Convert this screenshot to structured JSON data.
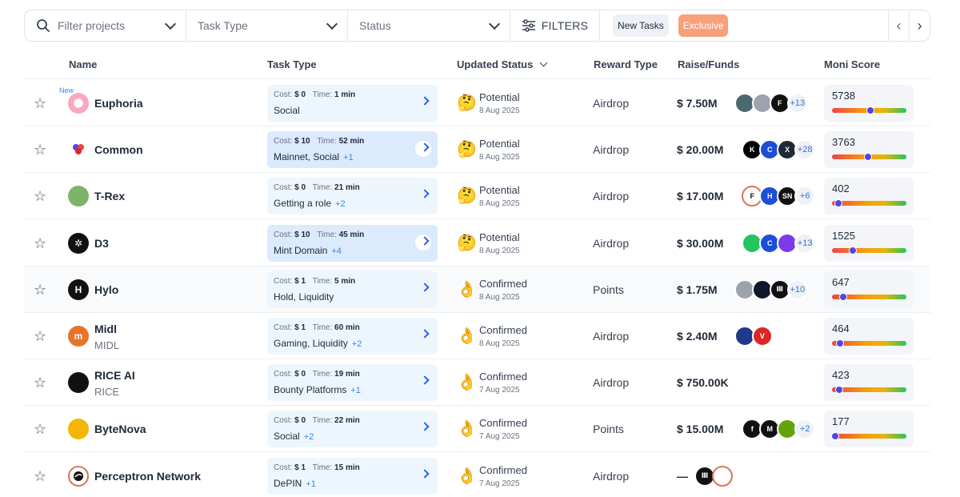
{
  "filters": {
    "search_placeholder": "Filter projects",
    "task_type": "Task Type",
    "status": "Status",
    "filters_label": "FILTERS",
    "chips": [
      "New Tasks",
      "Exclusive"
    ]
  },
  "columns": {
    "name": "Name",
    "task_type": "Task Type",
    "updated_status": "Updated Status",
    "reward_type": "Reward Type",
    "raise": "Raise/Funds",
    "moni": "Moni Score"
  },
  "labels": {
    "cost": "Cost:",
    "time": "Time:",
    "new": "New"
  },
  "rows": [
    {
      "name": "Euphoria",
      "sub": "",
      "is_new": true,
      "logo_color": "#f9a8c0",
      "logo_text": "",
      "cost": "$ 0",
      "time": "1 min",
      "task": "Social",
      "task_more": "",
      "status_emoji": "🤔",
      "status": "Potential",
      "date": "8 Aug 2025",
      "reward": "Airdrop",
      "raise": "$ 7.50M",
      "investors": [
        {
          "c": "#4b6a70",
          "t": ""
        },
        {
          "c": "#9ca3af",
          "t": ""
        },
        {
          "c": "#111111",
          "t": "F"
        }
      ],
      "investors_more": "+13",
      "moni": "5738",
      "moni_level": 0.52
    },
    {
      "name": "Common",
      "sub": "",
      "is_new": false,
      "logo_color": "#ffffff",
      "logo_text": "",
      "cost": "$ 10",
      "time": "52 min",
      "task": "Mainnet, Social",
      "task_more": "+1",
      "status_emoji": "🤔",
      "status": "Potential",
      "date": "8 Aug 2025",
      "reward": "Airdrop",
      "raise": "$ 20.00M",
      "investors": [
        {
          "c": "#000000",
          "t": "K"
        },
        {
          "c": "#1d4ed8",
          "t": "C"
        },
        {
          "c": "#1f2937",
          "t": "X"
        }
      ],
      "investors_more": "+28",
      "moni": "3763",
      "moni_level": 0.48
    },
    {
      "name": "T-Rex",
      "sub": "",
      "is_new": false,
      "logo_color": "#7fb36a",
      "logo_text": "",
      "cost": "$ 0",
      "time": "21 min",
      "task": "Getting a role",
      "task_more": "+2",
      "status_emoji": "🤔",
      "status": "Potential",
      "date": "8 Aug 2025",
      "reward": "Airdrop",
      "raise": "$ 17.00M",
      "investors": [
        {
          "c": "#ffffff",
          "t": "F"
        },
        {
          "c": "#1d4ed8",
          "t": "H"
        },
        {
          "c": "#111111",
          "t": "SN"
        }
      ],
      "investors_more": "+6",
      "moni": "402",
      "moni_level": 0.09
    },
    {
      "name": "D3",
      "sub": "",
      "is_new": false,
      "logo_color": "#111111",
      "logo_text": "✲",
      "cost": "$ 10",
      "time": "45 min",
      "task": "Mint Domain",
      "task_more": "+4",
      "status_emoji": "🤔",
      "status": "Potential",
      "date": "8 Aug 2025",
      "reward": "Airdrop",
      "raise": "$ 30.00M",
      "investors": [
        {
          "c": "#22c55e",
          "t": ""
        },
        {
          "c": "#1d4ed8",
          "t": "C"
        },
        {
          "c": "#7c3aed",
          "t": ""
        }
      ],
      "investors_more": "+13",
      "moni": "1525",
      "moni_level": 0.28
    },
    {
      "name": "Hylo",
      "sub": "",
      "is_new": false,
      "logo_color": "#111111",
      "logo_text": "H",
      "cost": "$ 1",
      "time": "5 min",
      "task": "Hold, Liquidity",
      "task_more": "",
      "status_emoji": "👌",
      "status": "Confirmed",
      "date": "8 Aug 2025",
      "reward": "Points",
      "raise": "$ 1.75M",
      "investors": [
        {
          "c": "#9ca3af",
          "t": ""
        },
        {
          "c": "#0f172a",
          "t": ""
        },
        {
          "c": "#111111",
          "t": "Ⅲ"
        }
      ],
      "investors_more": "+10",
      "moni": "647",
      "moni_level": 0.15
    },
    {
      "name": "Midl",
      "sub": "MIDL",
      "is_new": false,
      "logo_color": "#e8742c",
      "logo_text": "m",
      "cost": "$ 1",
      "time": "60 min",
      "task": "Gaming, Liquidity",
      "task_more": "+2",
      "status_emoji": "👌",
      "status": "Confirmed",
      "date": "8 Aug 2025",
      "reward": "Airdrop",
      "raise": "$ 2.40M",
      "investors": [
        {
          "c": "#1e3a8a",
          "t": ""
        },
        {
          "c": "#dc2626",
          "t": "V"
        }
      ],
      "investors_more": "",
      "moni": "464",
      "moni_level": 0.11
    },
    {
      "name": "RICE AI",
      "sub": "RICE",
      "is_new": false,
      "logo_color": "#111111",
      "logo_text": "",
      "cost": "$ 0",
      "time": "19 min",
      "task": "Bounty Platforms",
      "task_more": "+1",
      "status_emoji": "👌",
      "status": "Confirmed",
      "date": "7 Aug 2025",
      "reward": "Airdrop",
      "raise": "$ 750.00K",
      "investors": [],
      "investors_more": "",
      "moni": "423",
      "moni_level": 0.1
    },
    {
      "name": "ByteNova",
      "sub": "",
      "is_new": false,
      "logo_color": "#f2b705",
      "logo_text": "",
      "cost": "$ 0",
      "time": "22 min",
      "task": "Social",
      "task_more": "+2",
      "status_emoji": "👌",
      "status": "Confirmed",
      "date": "7 Aug 2025",
      "reward": "Points",
      "raise": "$ 15.00M",
      "investors": [
        {
          "c": "#111111",
          "t": "f"
        },
        {
          "c": "#111111",
          "t": "M"
        },
        {
          "c": "#65a30d",
          "t": ""
        }
      ],
      "investors_more": "+2",
      "moni": "177",
      "moni_level": 0.04
    },
    {
      "name": "Perceptron Network",
      "sub": "",
      "is_new": false,
      "logo_color": "#ffffff",
      "logo_text": "",
      "cost": "$ 1",
      "time": "15 min",
      "task": "DePIN",
      "task_more": "+1",
      "status_emoji": "👌",
      "status": "Confirmed",
      "date": "7 Aug 2025",
      "reward": "Airdrop",
      "raise": "—",
      "investors": [
        {
          "c": "#111111",
          "t": "Ⅲ"
        },
        {
          "c": "#ffffff",
          "t": ""
        }
      ],
      "investors_more": "",
      "moni": "",
      "moni_level": null
    }
  ]
}
